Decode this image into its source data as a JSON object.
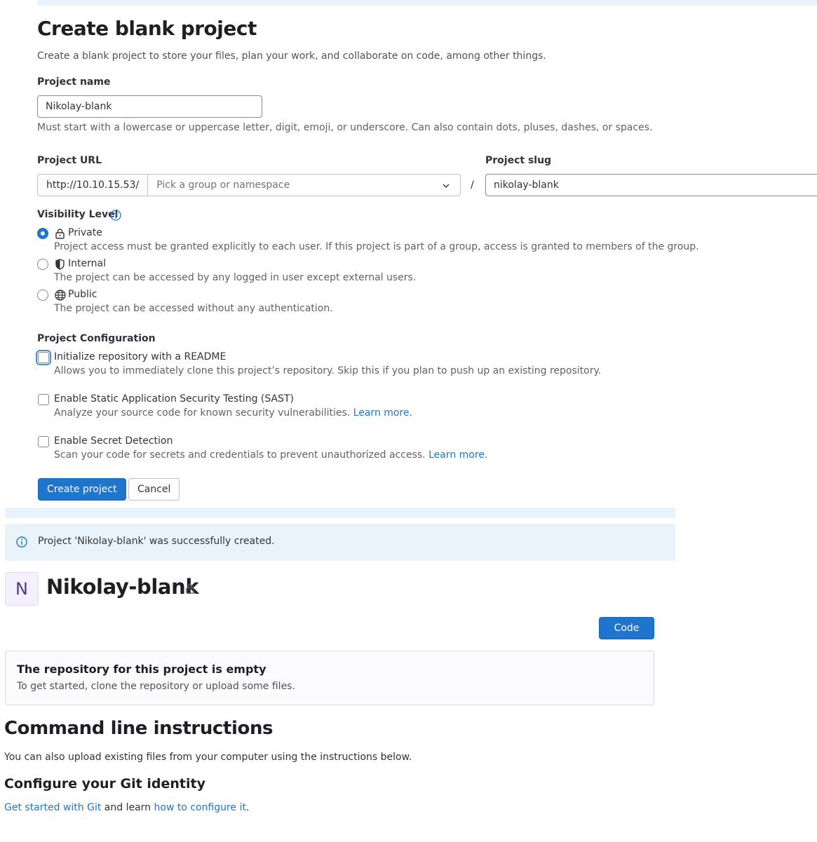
{
  "form": {
    "title": "Create blank project",
    "description": "Create a blank project to store your files, plan your work, and collaborate on code, among other things.",
    "project_name": {
      "label": "Project name",
      "value": "Nikolay-blank",
      "help": "Must start with a lowercase or uppercase letter, digit, emoji, or underscore. Can also contain dots, pluses, dashes, or spaces."
    },
    "project_url": {
      "label": "Project URL",
      "prefix": "http://10.10.15.53/",
      "namespace_placeholder": "Pick a group or namespace",
      "separator": "/"
    },
    "project_slug": {
      "label": "Project slug",
      "value": "nikolay-blank"
    },
    "visibility": {
      "label": "Visibility Level",
      "selected": "private",
      "options": [
        {
          "id": "private",
          "label": "Private",
          "icon": "lock-icon",
          "description": "Project access must be granted explicitly to each user. If this project is part of a group, access is granted to members of the group."
        },
        {
          "id": "internal",
          "label": "Internal",
          "icon": "shield-icon",
          "description": "The project can be accessed by any logged in user except external users."
        },
        {
          "id": "public",
          "label": "Public",
          "icon": "globe-icon",
          "description": "The project can be accessed without any authentication."
        }
      ]
    },
    "configuration": {
      "label": "Project Configuration",
      "options": [
        {
          "label": "Initialize repository with a README",
          "description": "Allows you to immediately clone this project’s repository. Skip this if you plan to push up an existing repository.",
          "checked": false,
          "link": ""
        },
        {
          "label": "Enable Static Application Security Testing (SAST)",
          "description": "Analyze your source code for known security vulnerabilities.",
          "checked": false,
          "link": "Learn more."
        },
        {
          "label": "Enable Secret Detection",
          "description": "Scan your code for secrets and credentials to prevent unauthorized access.",
          "checked": false,
          "link": "Learn more."
        }
      ]
    },
    "create_button": "Create project",
    "cancel_button": "Cancel"
  },
  "alert": {
    "message": "Project 'Nikolay-blank' was successfully created.",
    "icon": "info-icon"
  },
  "project": {
    "avatar_letter": "N",
    "name": "Nikolay-blank",
    "visibility_icon": "lock-icon",
    "code_button": "Code",
    "empty_title": "The repository for this project is empty",
    "empty_desc": "To get started, clone the repository or upload some files."
  },
  "cli": {
    "title": "Command line instructions",
    "desc": "You can also upload existing files from your computer using the instructions below.",
    "git_identity_title": "Configure your Git identity",
    "git_link_1": "Get started with Git",
    "git_middle": " and learn ",
    "git_link_2": "how to configure it",
    "git_end": "."
  },
  "colors": {
    "accent": "#1f75cb",
    "alert_bg": "#e9f3fc",
    "text": "#333238"
  }
}
